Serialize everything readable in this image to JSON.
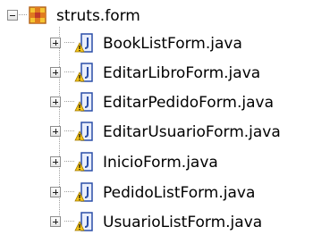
{
  "package": {
    "label": "struts.form",
    "expanded": true,
    "icon": "package-icon"
  },
  "files": [
    {
      "label": "BookListForm.java",
      "icon": "java-file-warning-icon",
      "expanded": false
    },
    {
      "label": "EditarLibroForm.java",
      "icon": "java-file-warning-icon",
      "expanded": false
    },
    {
      "label": "EditarPedidoForm.java",
      "icon": "java-file-warning-icon",
      "expanded": false
    },
    {
      "label": "EditarUsuarioForm.java",
      "icon": "java-file-warning-icon",
      "expanded": false
    },
    {
      "label": "InicioForm.java",
      "icon": "java-file-warning-icon",
      "expanded": false
    },
    {
      "label": "PedidoListForm.java",
      "icon": "java-file-warning-icon",
      "expanded": false
    },
    {
      "label": "UsuarioListForm.java",
      "icon": "java-file-warning-icon",
      "expanded": false
    }
  ],
  "colors": {
    "tree_line": "#a0a0a0",
    "package_brown": "#b5651d",
    "package_yellow": "#f5c431",
    "java_blue": "#2b4fa8",
    "warning_yellow": "#f3c317"
  }
}
